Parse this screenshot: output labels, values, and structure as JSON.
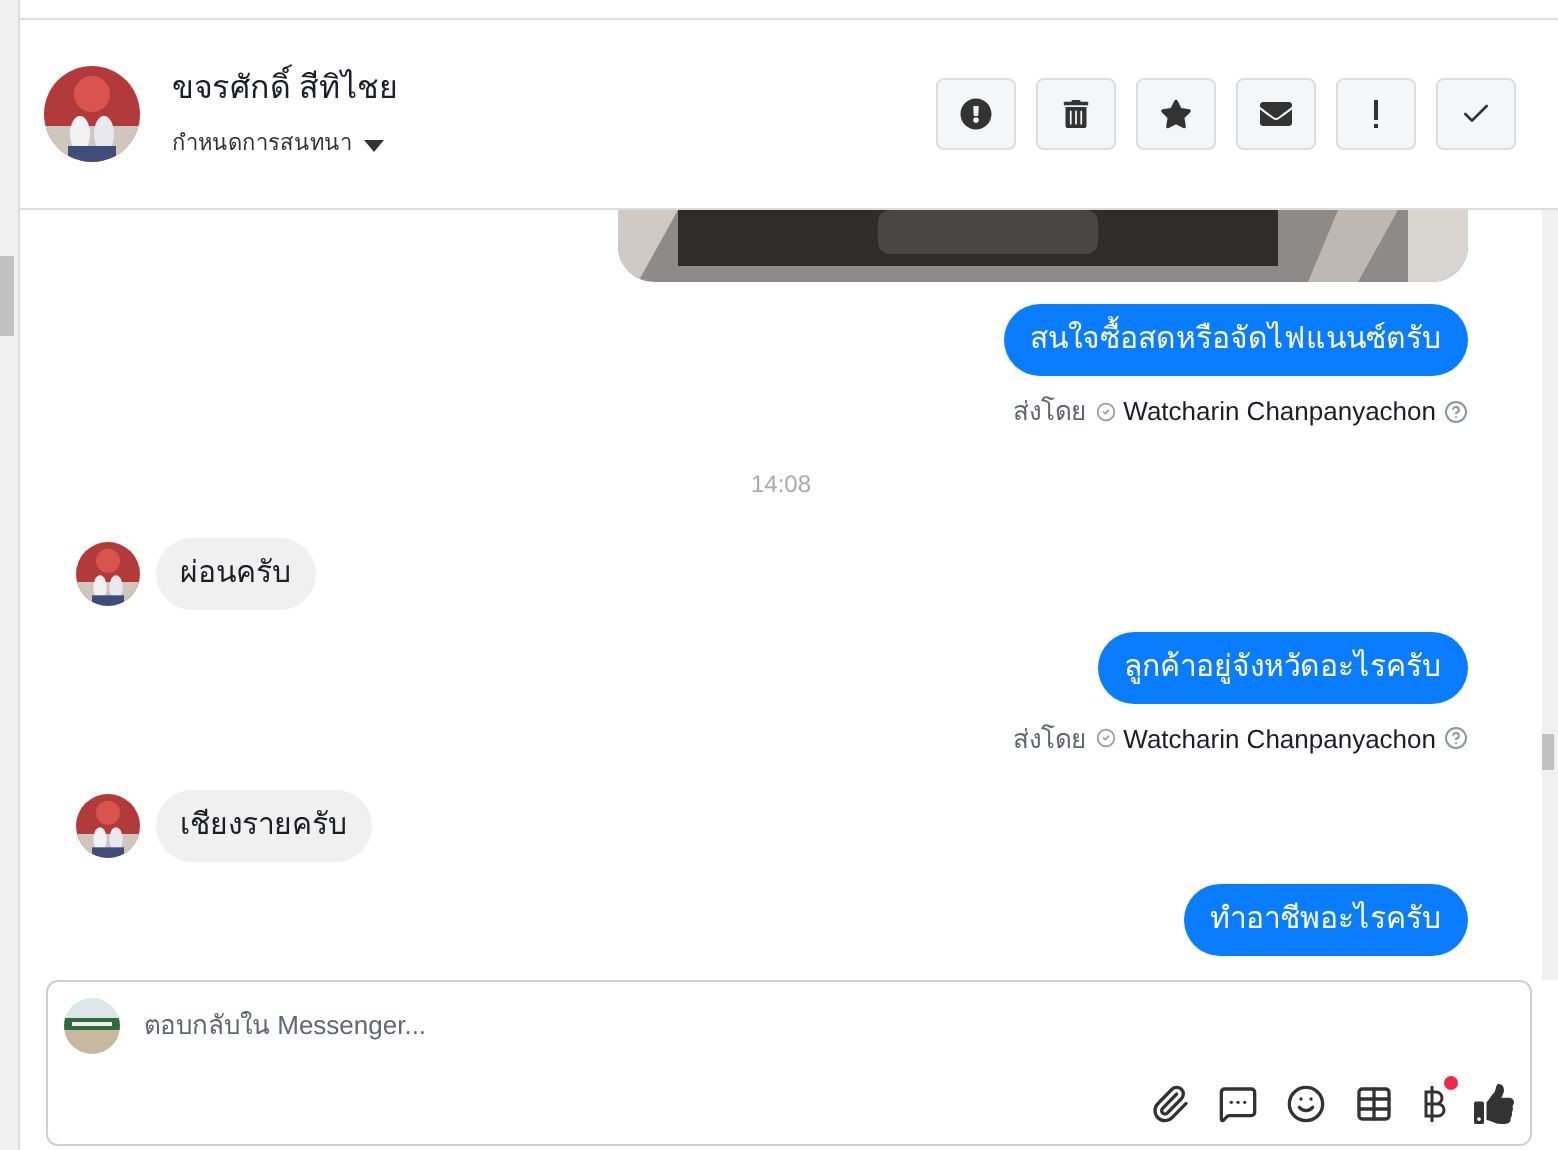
{
  "header": {
    "name": "ขจรศักดิ์ สีทิไชย",
    "subtitle": "กำหนดการสนทนา"
  },
  "messages": [
    {
      "kind": "picture"
    },
    {
      "kind": "outgoing",
      "text": "สนใจซื้อสดหรือจัดไฟแนนซ์ตรับ"
    },
    {
      "kind": "sent_by",
      "label": "ส่งโดย",
      "sender": "Watcharin Chanpanyachon"
    },
    {
      "kind": "time",
      "text": "14:08"
    },
    {
      "kind": "incoming",
      "text": "ผ่อนครับ"
    },
    {
      "kind": "outgoing",
      "text": "ลูกค้าอยู่จังหวัดอะไรครับ"
    },
    {
      "kind": "sent_by",
      "label": "ส่งโดย",
      "sender": "Watcharin Chanpanyachon"
    },
    {
      "kind": "incoming",
      "text": "เชียงรายครับ"
    },
    {
      "kind": "outgoing",
      "text": "ทำอาชีพอะไรครับ"
    }
  ],
  "composer": {
    "placeholder": "ตอบกลับใน Messenger..."
  }
}
